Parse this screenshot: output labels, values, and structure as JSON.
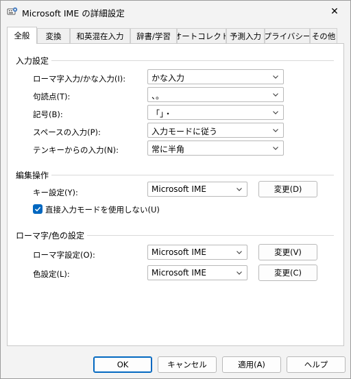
{
  "window": {
    "title": "Microsoft IME の詳細設定",
    "icon": "ime-settings-icon",
    "close_glyph": "✕"
  },
  "tabs": [
    {
      "label": "全般",
      "active": true
    },
    {
      "label": "変換",
      "active": false
    },
    {
      "label": "和英混在入力",
      "active": false
    },
    {
      "label": "辞書/学習",
      "active": false
    },
    {
      "label": "オートコレクト",
      "active": false
    },
    {
      "label": "予測入力",
      "active": false
    },
    {
      "label": "プライバシー",
      "active": false
    },
    {
      "label": "その他",
      "active": false
    }
  ],
  "input_settings": {
    "title": "入力設定",
    "rows": [
      {
        "label": "ローマ字入力/かな入力(I):",
        "value": "かな入力"
      },
      {
        "label": "句読点(T):",
        "value": "、。"
      },
      {
        "label": "記号(B):",
        "value": "「」・"
      },
      {
        "label": "スペースの入力(P):",
        "value": "入力モードに従う"
      },
      {
        "label": "テンキーからの入力(N):",
        "value": "常に半角"
      }
    ]
  },
  "edit_ops": {
    "title": "編集操作",
    "key_label": "キー設定(Y):",
    "key_value": "Microsoft IME",
    "key_button": "変更(D)",
    "direct_input_label": "直接入力モードを使用しない(U)",
    "direct_input_checked": true
  },
  "romaji_color": {
    "title": "ローマ字/色の設定",
    "romaji_label": "ローマ字設定(O):",
    "romaji_value": "Microsoft IME",
    "romaji_button": "変更(V)",
    "color_label": "色設定(L):",
    "color_value": "Microsoft IME",
    "color_button": "変更(C)"
  },
  "footer": {
    "ok": "OK",
    "cancel": "キャンセル",
    "apply": "適用(A)",
    "help": "ヘルプ"
  },
  "colors": {
    "accent": "#0067c0"
  }
}
